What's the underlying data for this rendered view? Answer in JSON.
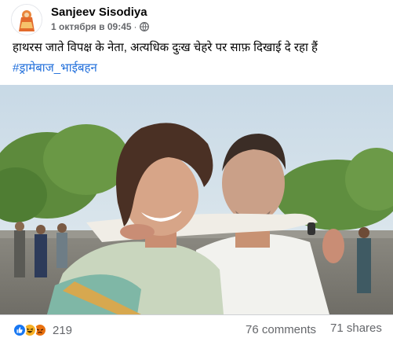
{
  "post": {
    "author": "Sanjeev Sisodiya",
    "timestamp": "1 октября в 09:45",
    "separator": "·",
    "privacy_icon": "globe-icon",
    "text": "हाथरस जाते विपक्ष के नेता, अत्यधिक दुःख चेहरे पर साफ़ दिखाई दे रहा हैं",
    "hashtag": "#ड्रामेबाज_भाईबहन"
  },
  "footer": {
    "reactions": [
      "like-icon",
      "haha-icon",
      "angry-icon"
    ],
    "reaction_count": "219",
    "comments": "76 comments",
    "shares": "71 shares"
  },
  "colors": {
    "link": "#216fdb",
    "secondary_text": "#65676b",
    "like_blue": "#1877f2",
    "haha_yellow": "#f7b125",
    "angry_orange": "#e9710f"
  }
}
